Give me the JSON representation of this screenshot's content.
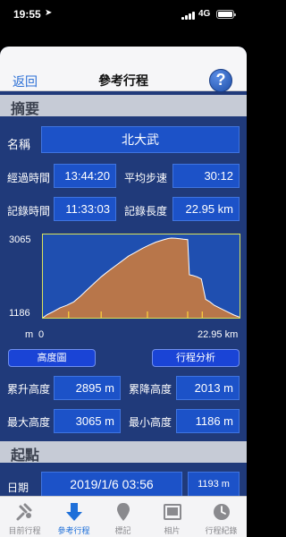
{
  "status_bar": {
    "time": "19:55",
    "network": "4G"
  },
  "nav": {
    "back_label": "返回",
    "title": "參考行程",
    "help_label": "?"
  },
  "summary": {
    "header": "摘要",
    "name_label": "名稱",
    "name_value": "北大武",
    "elapsed_label": "經過時間",
    "elapsed_value": "13:44:20",
    "avg_pace_label": "平均步速",
    "avg_pace_value": "30:12",
    "record_time_label": "記錄時間",
    "record_time_value": "11:33:03",
    "record_length_label": "記錄長度",
    "record_length_value": "22.95 km"
  },
  "chart_data": {
    "type": "area",
    "y_max_label": "3065",
    "y_min_label": "1186",
    "x_unit_label": "m",
    "x_start_label": "0",
    "x_end_label": "22.95 km",
    "ylim": [
      1186,
      3065
    ],
    "xlim": [
      0,
      22.95
    ],
    "x": [
      0,
      0.5,
      1.2,
      2.0,
      2.8,
      3.6,
      4.4,
      5.2,
      6.0,
      6.8,
      7.6,
      8.4,
      9.2,
      10.0,
      10.8,
      11.6,
      12.4,
      13.2,
      14.0,
      14.6,
      15.0,
      15.5,
      16.0,
      16.4,
      16.9,
      17.1,
      17.5,
      18.0,
      18.5,
      19.0,
      19.5,
      20.0,
      20.8,
      21.6,
      22.3,
      22.95
    ],
    "y": [
      1186,
      1260,
      1330,
      1420,
      1480,
      1560,
      1700,
      1850,
      2000,
      2150,
      2280,
      2400,
      2520,
      2640,
      2730,
      2820,
      2900,
      2970,
      3020,
      3055,
      3065,
      3060,
      3050,
      3040,
      3030,
      2200,
      2180,
      2150,
      2100,
      1620,
      1560,
      1480,
      1400,
      1320,
      1250,
      1200
    ],
    "markers_x": [
      3.0,
      6.8,
      12.2,
      16.9,
      18.6
    ],
    "colors": {
      "fill": "#b8764a",
      "line": "#ffffff",
      "frame": "#d9e35a",
      "marker": "#ffd43b"
    }
  },
  "buttons": {
    "profile": "高度圖",
    "analysis": "行程分析"
  },
  "elevation": {
    "total_ascent_label": "累升高度",
    "total_ascent_value": "2895 m",
    "total_descent_label": "累降高度",
    "total_descent_value": "2013 m",
    "max_label": "最大高度",
    "max_value": "3065 m",
    "min_label": "最小高度",
    "min_value": "1186 m"
  },
  "start": {
    "header": "起點",
    "date_label": "日期",
    "date_value": "2019/1/6 03:56",
    "altitude_value": "1193 m"
  },
  "tabs": [
    {
      "label": "目前行程",
      "icon": "satellite-icon",
      "active": false
    },
    {
      "label": "參考行程",
      "icon": "down-arrow-icon",
      "active": true
    },
    {
      "label": "標記",
      "icon": "map-pin-icon",
      "active": false
    },
    {
      "label": "相片",
      "icon": "photo-frame-icon",
      "active": false
    },
    {
      "label": "行程紀錄",
      "icon": "clock-icon",
      "active": false
    }
  ],
  "colors": {
    "background": "#203a7a",
    "value_box": "#1c52c8",
    "accent": "#1e6fd9"
  }
}
